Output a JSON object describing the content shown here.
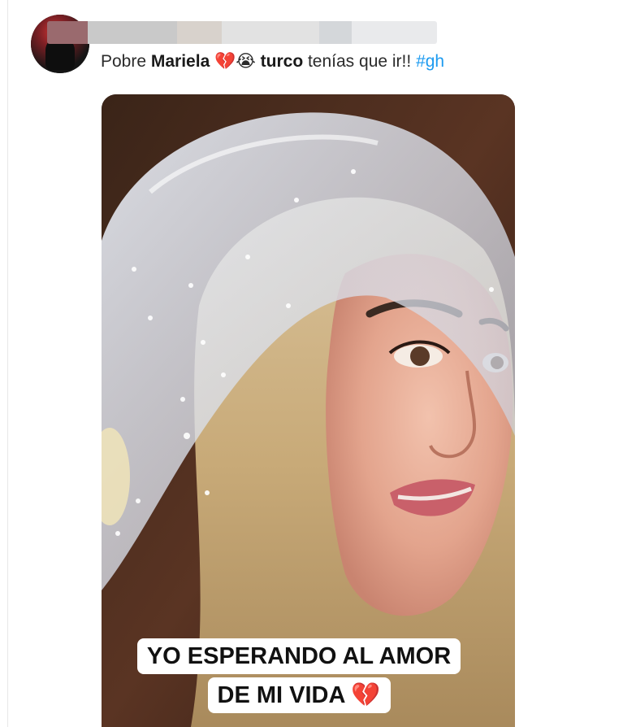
{
  "tweet": {
    "author_avatar": "avatar-photo",
    "author_name_blurred": true,
    "text_prefix": "Pobre ",
    "mention_bold_1": "Mariela",
    "emoji_1": "💔",
    "emoji_2": "😭",
    "mention_bold_2": "turco",
    "text_middle": " tenías que ir!! ",
    "hashtag": "#gh"
  },
  "media": {
    "caption_line_1": "YO ESPERANDO AL AMOR",
    "caption_line_2": "DE MI VIDA",
    "caption_emoji": "💔"
  },
  "colors": {
    "hashtag": "#1d9bf0",
    "text": "#2b2b2b"
  }
}
